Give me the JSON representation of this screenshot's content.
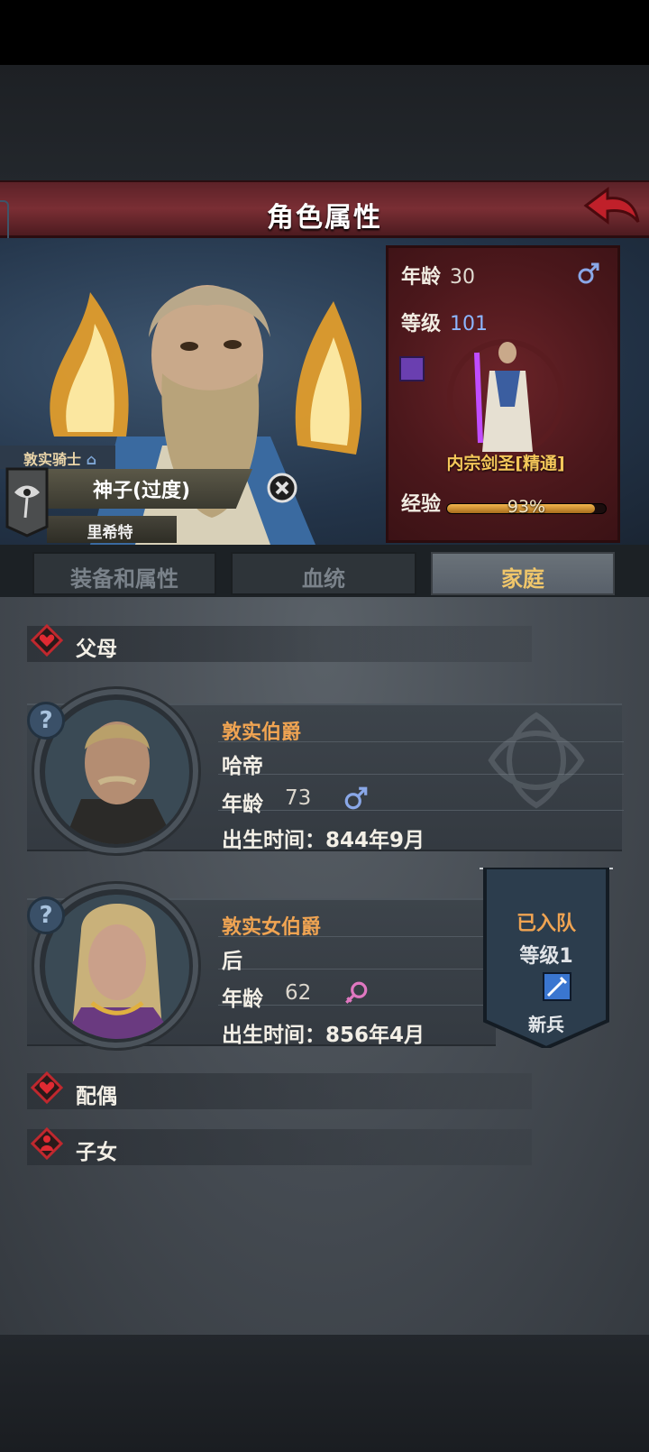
{
  "header": {
    "title": "角色属性"
  },
  "hero": {
    "rank": "敦实骑士",
    "name": "神子(过度)",
    "subname": "里希特"
  },
  "info": {
    "age_label": "年龄",
    "age": "30",
    "level_label": "等级",
    "level": "101",
    "class": "内宗剑圣[精通]",
    "exp_label": "经验",
    "exp_percent": 93,
    "exp_text": "93%"
  },
  "tabs": [
    {
      "label": "装备和属性"
    },
    {
      "label": "血统"
    },
    {
      "label": "家庭"
    }
  ],
  "sections": {
    "parents": "父母",
    "spouse": "配偶",
    "children": "子女"
  },
  "father": {
    "title": "敦实伯爵",
    "name": "哈帝",
    "age_label": "年龄",
    "age": "73",
    "birth": "出生时间：844年9月",
    "gender": "male"
  },
  "mother": {
    "title": "敦实女伯爵",
    "name": "后",
    "age_label": "年龄",
    "age": "62",
    "birth": "出生时间：856年4月",
    "gender": "female"
  },
  "team": {
    "status": "已入队",
    "level": "等级1",
    "role": "新兵"
  },
  "colors": {
    "accent_gold": "#f0a452",
    "male": "#8aa8e8",
    "female": "#e077c0",
    "header_red": "#7a2e34"
  }
}
